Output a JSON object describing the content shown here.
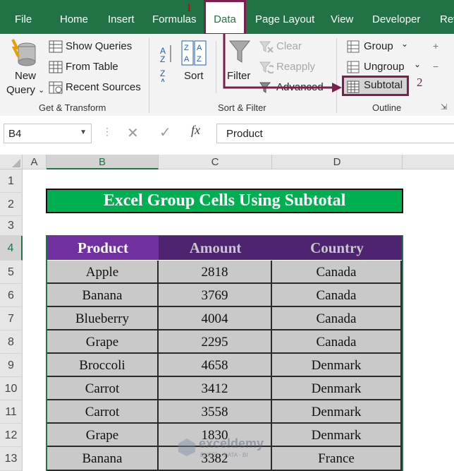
{
  "tabs": [
    "File",
    "Home",
    "Insert",
    "Formulas",
    "Data",
    "Page Layout",
    "View",
    "Developer",
    "Rev"
  ],
  "active_tab": "Data",
  "ribbon": {
    "get_transform": {
      "new_query_line1": "New",
      "new_query_line2": "Query",
      "show_queries": "Show Queries",
      "from_table": "From Table",
      "recent_sources": "Recent Sources",
      "group_label": "Get & Transform"
    },
    "sort_filter": {
      "sort": "Sort",
      "filter": "Filter",
      "clear": "Clear",
      "reapply": "Reapply",
      "advanced": "Advanced",
      "group_label": "Sort & Filter"
    },
    "outline": {
      "group": "Group",
      "ungroup": "Ungroup",
      "subtotal": "Subtotal",
      "group_label": "Outline"
    }
  },
  "annotations": {
    "step1": "1",
    "step2": "2"
  },
  "formula_bar": {
    "name_box": "B4",
    "fx": "fx",
    "content": "Product"
  },
  "columns": [
    "A",
    "B",
    "C",
    "D"
  ],
  "rows": [
    "1",
    "2",
    "3",
    "4",
    "5",
    "6",
    "7",
    "8",
    "9",
    "10",
    "11",
    "12",
    "13"
  ],
  "sheet": {
    "title": "Excel Group Cells Using Subtotal",
    "headers": [
      "Product",
      "Amount",
      "Country"
    ],
    "data": [
      [
        "Apple",
        "2818",
        "Canada"
      ],
      [
        "Banana",
        "3769",
        "Canada"
      ],
      [
        "Blueberry",
        "4004",
        "Canada"
      ],
      [
        "Grape",
        "2295",
        "Canada"
      ],
      [
        "Broccoli",
        "4658",
        "Denmark"
      ],
      [
        "Carrot",
        "3412",
        "Denmark"
      ],
      [
        "Carrot",
        "3558",
        "Denmark"
      ],
      [
        "Grape",
        "1830",
        "Denmark"
      ],
      [
        "Banana",
        "3382",
        "France"
      ]
    ]
  },
  "watermark": {
    "brand": "exceldemy",
    "tagline": "EXCEL · DATA · BI"
  },
  "colors": {
    "excel_green": "#217346",
    "annotation": "#7b1f4e",
    "title_bg": "#00b050",
    "header_purple": "#7030a0",
    "cell_gray": "#c9c9c9"
  }
}
